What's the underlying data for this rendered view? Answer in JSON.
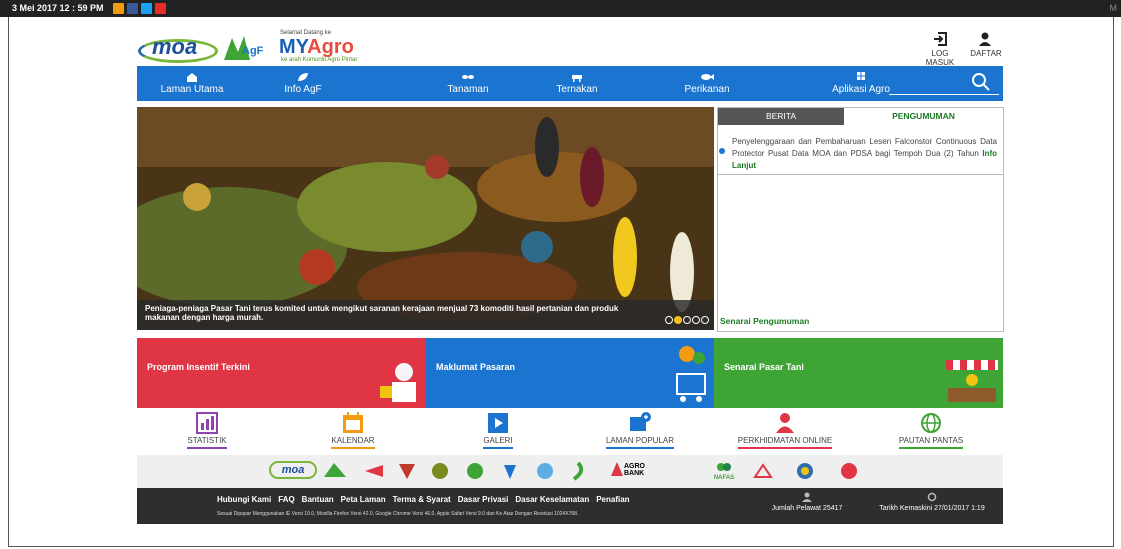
{
  "topbar": {
    "datetime": "3 Mei 2017  12 : 59  PM",
    "right_letter": "M"
  },
  "logos": {
    "moa": "moa",
    "agf": "AgF",
    "myagro_welcome": "Selamat Datang ke",
    "myagro_my": "MY",
    "myagro_agro": "Agro",
    "myagro_sub": "ke arah Komuniti Agro Pintar"
  },
  "account": {
    "login": "LOG MASUK",
    "register": "DAFTAR"
  },
  "nav": {
    "items": [
      "Laman Utama",
      "Info AgF",
      "Tanaman",
      "Ternakan",
      "Perikanan",
      "Aplikasi Agro"
    ]
  },
  "hero": {
    "caption": "Peniaga-peniaga Pasar Tani terus komited untuk mengikut saranan kerajaan menjual 73 komoditi hasil pertanian dan produk makanan dengan harga murah.",
    "slides": 6,
    "active_slide": 2
  },
  "news": {
    "tab_berita": "BERITA",
    "tab_pengumuman": "PENGUMUMAN",
    "item_text": "Penyelenggaraan dan Pembaharuan Lesen Falconstor Continuous Data Protector Pusat Data MOA dan PDSA bagi Tempoh Dua (2) Tahun",
    "item_link": "Info Lanjut",
    "list_link": "Senarai Pengumuman"
  },
  "banners": [
    {
      "title": "Program Insentif Terkini",
      "color": "#e03545"
    },
    {
      "title": "Maklumat Pasaran",
      "color": "#1b74cf"
    },
    {
      "title": "Senarai Pasar Tani",
      "color": "#3fa436"
    }
  ],
  "quicklinks": [
    {
      "label": "STATISTIK",
      "color": "#8e44ad"
    },
    {
      "label": "KALENDAR",
      "color": "#f39c12"
    },
    {
      "label": "GALERI",
      "color": "#1b74cf"
    },
    {
      "label": "LAMAN POPULAR",
      "color": "#1b74cf"
    },
    {
      "label": "PERKHIDMATAN ONLINE",
      "color": "#e03545"
    },
    {
      "label": "PAUTAN PANTAS",
      "color": "#3fa436"
    }
  ],
  "partners": {
    "moa": "moa",
    "agrobank": "AGRO BANK",
    "nafas": "NAFAS"
  },
  "footer": {
    "links": [
      "Hubungi Kami",
      "FAQ",
      "Bantuan",
      "Peta Laman",
      "Terma & Syarat",
      "Dasar Privasi",
      "Dasar Keselamatan",
      "Penafian"
    ],
    "browser_note": "Sesuai Dipapar Menggunakan IE Versi 10.0, Mozilla Firefox Versi 42.0, Google Chrome Versi 46.0, Apple Safari Versi 9.0 dan Ke Atas Dengan Resolusi 1024X768.",
    "visitors": "Jumlah Pelawat 25417",
    "updated": "Tarikh Kemaskini 27/01/2017 1:19"
  }
}
